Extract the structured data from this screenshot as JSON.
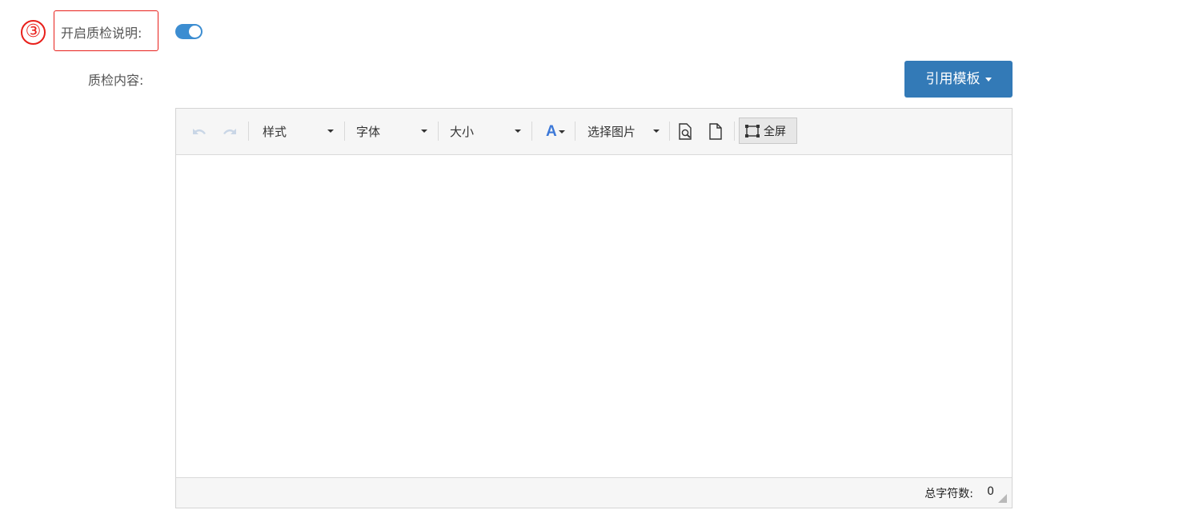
{
  "annotation": {
    "step_number": "③"
  },
  "form": {
    "enable_label": "开启质检说明:",
    "enable_value": true,
    "content_label": "质检内容:",
    "template_button": "引用模板"
  },
  "editor": {
    "toolbar": {
      "undo_icon": "undo-icon",
      "redo_icon": "redo-icon",
      "style_select": "样式",
      "font_select": "字体",
      "size_select": "大小",
      "font_color_icon": "A",
      "image_select": "选择图片",
      "preview_icon": "preview-icon",
      "new_doc_icon": "new-document-icon",
      "fullscreen_label": "全屏"
    },
    "status": {
      "word_count_label": "总字符数:",
      "word_count_value": "0"
    }
  },
  "colors": {
    "accent": "#337ab7",
    "toggle_on": "#3c8dd1",
    "annotation_red": "#e8201b"
  }
}
